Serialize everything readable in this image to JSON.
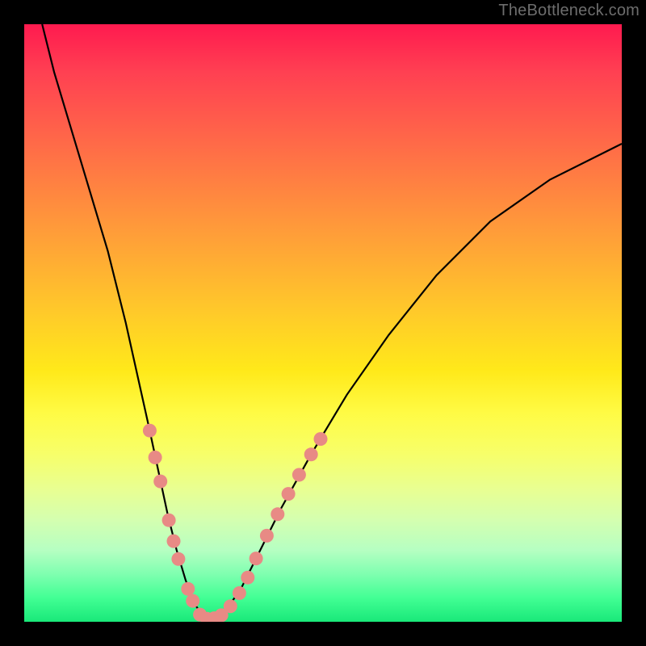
{
  "watermark": "TheBottleneck.com",
  "chart_data": {
    "type": "line",
    "title": "",
    "xlabel": "",
    "ylabel": "",
    "xlim": [
      0,
      100
    ],
    "ylim": [
      0,
      100
    ],
    "series": [
      {
        "name": "curve",
        "x": [
          3,
          5,
          8,
          11,
          14,
          17,
          19,
          21,
          22.5,
          24,
          25.5,
          27,
          28.5,
          30,
          31.5,
          33,
          36,
          39,
          43,
          48,
          54,
          61,
          69,
          78,
          88,
          100
        ],
        "y": [
          100,
          92,
          82,
          72,
          62,
          50,
          41,
          32,
          25,
          18,
          12,
          7,
          3,
          0.8,
          0.3,
          1.2,
          5,
          11,
          19,
          28,
          38,
          48,
          58,
          67,
          74,
          80
        ]
      }
    ],
    "markers": {
      "name": "highlighted-points",
      "points": [
        {
          "x": 21.0,
          "y": 32.0
        },
        {
          "x": 21.9,
          "y": 27.5
        },
        {
          "x": 22.8,
          "y": 23.5
        },
        {
          "x": 24.2,
          "y": 17.0
        },
        {
          "x": 25.0,
          "y": 13.5
        },
        {
          "x": 25.8,
          "y": 10.5
        },
        {
          "x": 27.4,
          "y": 5.5
        },
        {
          "x": 28.2,
          "y": 3.5
        },
        {
          "x": 29.4,
          "y": 1.2
        },
        {
          "x": 30.6,
          "y": 0.5
        },
        {
          "x": 31.8,
          "y": 0.6
        },
        {
          "x": 33.0,
          "y": 1.1
        },
        {
          "x": 34.5,
          "y": 2.6
        },
        {
          "x": 36.0,
          "y": 4.8
        },
        {
          "x": 37.4,
          "y": 7.4
        },
        {
          "x": 38.8,
          "y": 10.6
        },
        {
          "x": 40.6,
          "y": 14.4
        },
        {
          "x": 42.4,
          "y": 18.0
        },
        {
          "x": 44.2,
          "y": 21.4
        },
        {
          "x": 46.0,
          "y": 24.6
        },
        {
          "x": 48.0,
          "y": 28.0
        },
        {
          "x": 49.6,
          "y": 30.6
        }
      ]
    },
    "background": "rainbow-vertical-gradient",
    "grid": false,
    "legend": false
  },
  "colors": {
    "curve": "#000000",
    "marker": "#e88a85",
    "frame_border": "#000000"
  }
}
